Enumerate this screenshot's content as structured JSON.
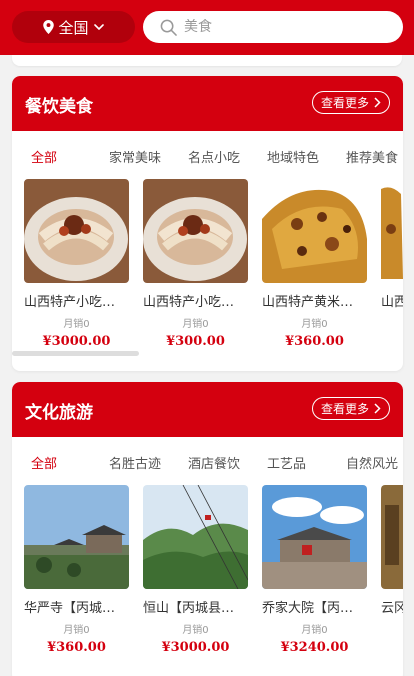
{
  "header": {
    "location_label": "全国",
    "search_placeholder": "美食"
  },
  "sections": [
    {
      "title": "餐饮美食",
      "more_label": "查看更多",
      "tabs": [
        "全部",
        "家常美味",
        "名点小吃",
        "地域特色",
        "推荐美食"
      ],
      "products": [
        {
          "name": "山西特产小吃…",
          "sales": "月销0",
          "price": "¥3000.00",
          "image": "dumpling-plate"
        },
        {
          "name": "山西特产小吃…",
          "sales": "月销0",
          "price": "¥300.00",
          "image": "dumpling-plate"
        },
        {
          "name": "山西特产黄米…",
          "sales": "月销0",
          "price": "¥360.00",
          "image": "fried-cake"
        },
        {
          "name": "山西",
          "sales": "",
          "price": "",
          "image": "fried-cake"
        }
      ]
    },
    {
      "title": "文化旅游",
      "more_label": "查看更多",
      "tabs": [
        "全部",
        "名胜古迹",
        "酒店餐饮",
        "工艺品",
        "自然风光"
      ],
      "products": [
        {
          "name": "华严寺【丙城…",
          "sales": "月销0",
          "price": "¥360.00",
          "image": "temple"
        },
        {
          "name": "恒山【丙城县…",
          "sales": "月销0",
          "price": "¥3000.00",
          "image": "mountain-cable"
        },
        {
          "name": "乔家大院【丙…",
          "sales": "月销0",
          "price": "¥3240.00",
          "image": "courtyard"
        },
        {
          "name": "云冈",
          "sales": "",
          "price": "",
          "image": "grotto"
        }
      ]
    }
  ],
  "colors": {
    "brand_red": "#d4000f",
    "location_pill": "#b1000c"
  }
}
